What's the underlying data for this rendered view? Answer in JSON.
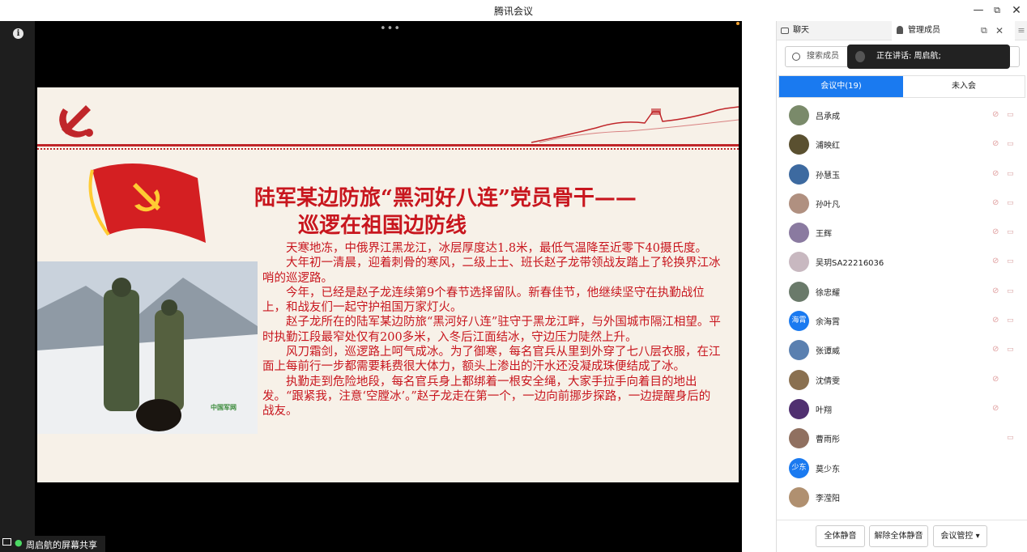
{
  "window": {
    "title": "腾讯会议",
    "min": "—",
    "max": "⧉",
    "close": "✕"
  },
  "stage": {
    "more": "•••",
    "share_label": "周启航的屏幕共享"
  },
  "slide": {
    "title_line1": "陆军某边防旅“黑河好八连”党员骨干——",
    "title_line2": "巡逻在祖国边防线",
    "paragraphs": [
      "天寒地冻，中俄界江黑龙江，冰层厚度达1.8米，最低气温降至近零下40摄氏度。",
      "大年初一清晨，迎着刺骨的寒风，二级上士、班长赵子龙带领战友踏上了轮换界江冰哨的巡逻路。",
      "今年，已经是赵子龙连续第9个春节选择留队。新春佳节，他继续坚守在执勤战位上，和战友们一起守护祖国万家灯火。",
      "赵子龙所在的陆军某边防旅“黑河好八连”驻守于黑龙江畔，与外国城市隔江相望。平时执勤江段最窄处仅有200多米，入冬后江面结冰，守边压力陡然上升。",
      "风刀霜剑，巡逻路上呵气成冰。为了御寒，每名官兵从里到外穿了七八层衣服，在江面上每前行一步都需要耗费很大体力，额头上渗出的汗水还没凝成珠便结成了冰。",
      "执勤走到危险地段，每名官兵身上都绑着一根安全绳，大家手拉手向着目的地出发。“跟紧我，注意‘空膛冰’。”赵子龙走在第一个，一边向前挪步探路，一边提醒身后的战友。"
    ],
    "photo_logo": "中国军网"
  },
  "panel": {
    "tab_chat": "聊天",
    "tab_members": "管理成员",
    "tab_side": "≡",
    "search_placeholder": "搜索成员",
    "speaking": "正在讲话: 周启航;",
    "seg_in": "会议中(19)",
    "seg_out": "未入会",
    "members": [
      {
        "name": "吕承成",
        "avatar_color": "#7a8a6a",
        "avatar_text": "",
        "mic_off": true,
        "cam_off": true
      },
      {
        "name": "浦映红",
        "avatar_color": "#5a5030",
        "avatar_text": "",
        "mic_off": true,
        "cam_off": true
      },
      {
        "name": "孙慧玉",
        "avatar_color": "#3d6aa0",
        "avatar_text": "",
        "mic_off": true,
        "cam_off": true
      },
      {
        "name": "孙叶凡",
        "avatar_color": "#b09080",
        "avatar_text": "",
        "mic_off": true,
        "cam_off": true
      },
      {
        "name": "王辉",
        "avatar_color": "#8a7aa0",
        "avatar_text": "",
        "mic_off": true,
        "cam_off": true
      },
      {
        "name": "吴玥SA22216036",
        "avatar_color": "#c8b8c0",
        "avatar_text": "",
        "mic_off": true,
        "cam_off": true
      },
      {
        "name": "徐忠耀",
        "avatar_color": "#6a7a6a",
        "avatar_text": "",
        "mic_off": true,
        "cam_off": true
      },
      {
        "name": "余海霄",
        "avatar_color": "#1a7af0",
        "avatar_text": "海霄",
        "mic_off": true,
        "cam_off": true
      },
      {
        "name": "张谭威",
        "avatar_color": "#5a80b0",
        "avatar_text": "",
        "mic_off": true,
        "cam_off": true
      },
      {
        "name": "沈倩雯",
        "avatar_color": "#8a7050",
        "avatar_text": "",
        "mic_off": true,
        "cam_off": false
      },
      {
        "name": "叶翔",
        "avatar_color": "#503070",
        "avatar_text": "",
        "mic_off": true,
        "cam_off": false
      },
      {
        "name": "曹雨彤",
        "avatar_color": "#907060",
        "avatar_text": "",
        "mic_off": false,
        "cam_off": true
      },
      {
        "name": "莫少东",
        "avatar_color": "#1a7af0",
        "avatar_text": "少东",
        "mic_off": false,
        "cam_off": false
      },
      {
        "name": "李滢阳",
        "avatar_color": "#b09070",
        "avatar_text": "",
        "mic_off": false,
        "cam_off": false
      }
    ],
    "btn_mute_all": "全体静音",
    "btn_unmute_all": "解除全体静音",
    "btn_control": "会议管控 ▾"
  }
}
